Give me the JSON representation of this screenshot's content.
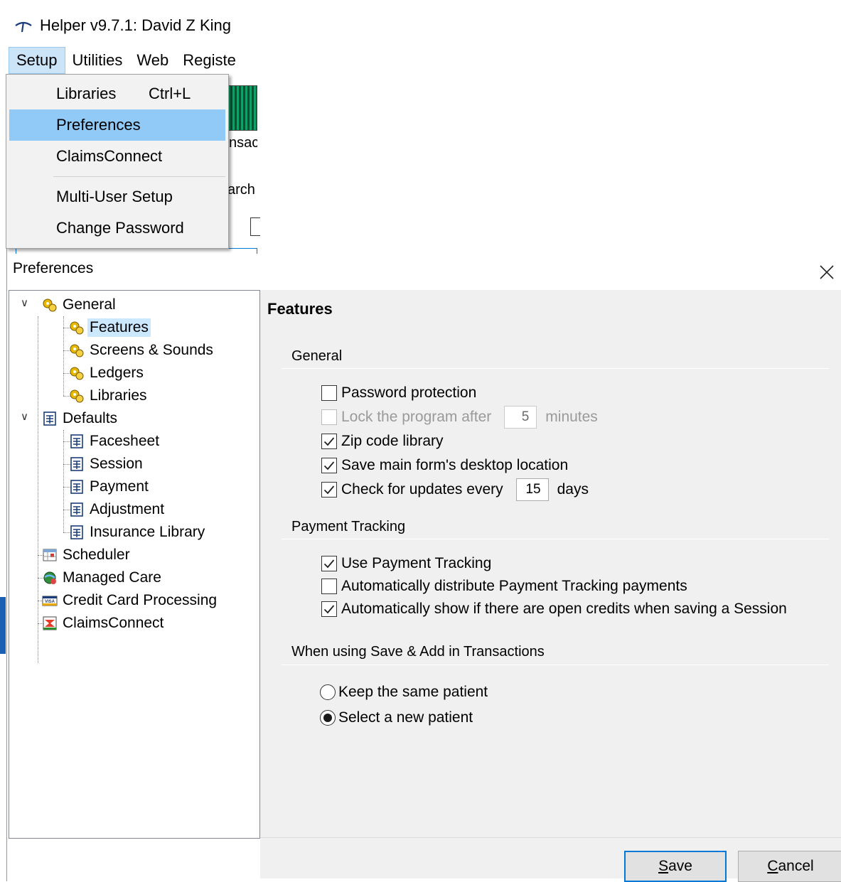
{
  "app": {
    "title": "Helper v9.7.1: David Z King",
    "menu": [
      "Setup",
      "Utilities",
      "Web",
      "Registe"
    ],
    "background_fragments": [
      "nsac",
      "arch"
    ]
  },
  "setup_menu": {
    "items": [
      {
        "label": "Libraries",
        "shortcut": "Ctrl+L"
      },
      {
        "label": "Preferences",
        "shortcut": ""
      },
      {
        "label": "ClaimsConnect",
        "shortcut": ""
      },
      {
        "label": "Multi-User Setup",
        "shortcut": ""
      },
      {
        "label": "Change Password",
        "shortcut": ""
      }
    ],
    "selected": "Preferences"
  },
  "dialog": {
    "title": "Preferences",
    "close_glyph": "×",
    "tree": {
      "general": "General",
      "features": "Features",
      "screens_sounds": "Screens & Sounds",
      "ledgers": "Ledgers",
      "libraries": "Libraries",
      "defaults": "Defaults",
      "facesheet": "Facesheet",
      "session": "Session",
      "payment": "Payment",
      "adjustment": "Adjustment",
      "insurance_library": "Insurance Library",
      "scheduler": "Scheduler",
      "managed_care": "Managed Care",
      "credit_card": "Credit Card Processing",
      "claimsconnect": "ClaimsConnect"
    },
    "panel": {
      "heading": "Features",
      "general": {
        "header": "General",
        "password_protection": {
          "label": "Password protection",
          "checked": false
        },
        "lock_program": {
          "label": "Lock the program after",
          "value": "5",
          "unit": "minutes",
          "checked": false,
          "disabled": true
        },
        "zip_code": {
          "label": "Zip code library",
          "checked": true
        },
        "save_location": {
          "label": "Save main form's desktop location",
          "checked": true
        },
        "check_updates": {
          "label": "Check for updates every",
          "value": "15",
          "unit": "days",
          "checked": true
        }
      },
      "payment_tracking": {
        "header": "Payment Tracking",
        "use": {
          "label": "Use Payment Tracking",
          "checked": true
        },
        "auto_distribute": {
          "label": "Automatically distribute Payment Tracking payments",
          "checked": false
        },
        "show_credits": {
          "label": "Automatically show if there are open credits when saving a Session",
          "checked": true
        }
      },
      "save_add": {
        "header": "When using Save & Add in Transactions",
        "keep_same": {
          "label": "Keep the same patient",
          "selected": false
        },
        "select_new": {
          "label": "Select a new patient",
          "selected": true
        }
      }
    },
    "buttons": {
      "save_first": "S",
      "save_rest": "ave",
      "cancel_first": "C",
      "cancel_rest": "ancel"
    }
  },
  "colors": {
    "menu_highlight": "#91c9f7",
    "tree_selection": "#cce8ff",
    "panel_bg": "#f0f0f0",
    "default_button_border": "#0078d7"
  }
}
